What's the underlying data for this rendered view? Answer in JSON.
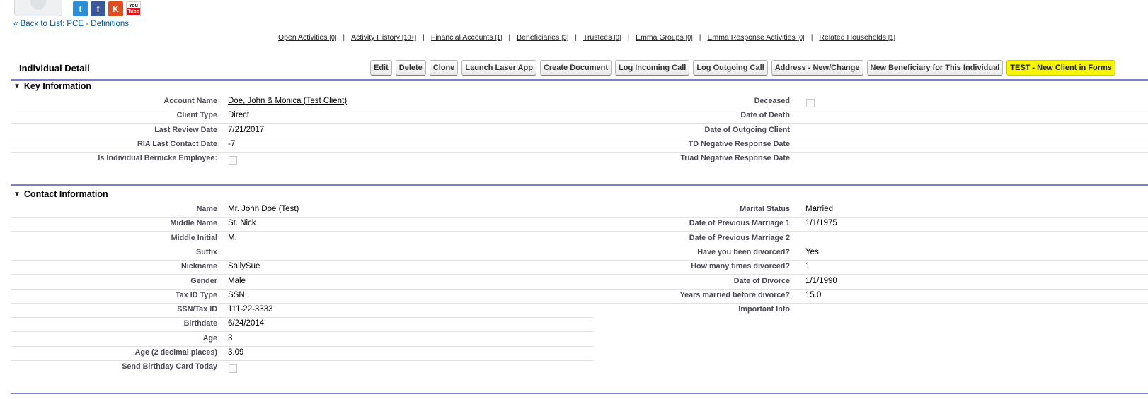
{
  "social": {
    "twitter": "t",
    "facebook": "f",
    "klout": "K",
    "youtube_top": "You",
    "youtube_bottom": "Tube"
  },
  "back_link": "« Back to List: PCE - Definitions",
  "related_lists": [
    {
      "label": "Open Activities",
      "count": "[0]"
    },
    {
      "label": "Activity History",
      "count": "[10+]"
    },
    {
      "label": "Financial Accounts",
      "count": "[1]"
    },
    {
      "label": "Beneficiaries",
      "count": "[3]"
    },
    {
      "label": "Trustees",
      "count": "[0]"
    },
    {
      "label": "Emma Groups",
      "count": "[0]"
    },
    {
      "label": "Emma Response Activities",
      "count": "[0]"
    },
    {
      "label": "Related Households",
      "count": "[1]"
    }
  ],
  "related_separator": "|",
  "detail": {
    "title": "Individual Detail",
    "buttons": [
      "Edit",
      "Delete",
      "Clone",
      "Launch Laser App",
      "Create Document",
      "Log Incoming Call",
      "Log Outgoing Call",
      "Address - New/Change",
      "New Beneficiary for This Individual",
      "TEST - New Client in Forms"
    ],
    "highlight_color": "#f6f600"
  },
  "key_info": {
    "title": "Key Information",
    "left": [
      {
        "label": "Account Name",
        "value": "Doe, John & Monica (Test Client)",
        "link": true
      },
      {
        "label": "Client Type",
        "value": "Direct"
      },
      {
        "label": "Last Review Date",
        "value": "7/21/2017"
      },
      {
        "label": "RIA Last Contact Date",
        "value": "-7"
      },
      {
        "label": "Is Individual Bernicke Employee:",
        "value": "",
        "checkbox": true
      }
    ],
    "right": [
      {
        "label": "Deceased",
        "value": "",
        "checkbox": true
      },
      {
        "label": "Date of Death",
        "value": ""
      },
      {
        "label": "Date of Outgoing Client",
        "value": ""
      },
      {
        "label": "TD Negative Response Date",
        "value": ""
      },
      {
        "label": "Triad Negative Response Date",
        "value": ""
      }
    ]
  },
  "contact_info": {
    "title": "Contact Information",
    "left": [
      {
        "label": "Name",
        "value": "Mr. John Doe (Test)"
      },
      {
        "label": "Middle Name",
        "value": "St. Nick"
      },
      {
        "label": "Middle Initial",
        "value": "M."
      },
      {
        "label": "Suffix",
        "value": ""
      },
      {
        "label": "Nickname",
        "value": "SallySue"
      },
      {
        "label": "Gender",
        "value": "Male"
      },
      {
        "label": "Tax ID Type",
        "value": "SSN"
      },
      {
        "label": "SSN/Tax ID",
        "value": "111-22-3333"
      },
      {
        "label": "Birthdate",
        "value": "6/24/2014"
      },
      {
        "label": "Age",
        "value": "3"
      },
      {
        "label": "Age (2 decimal places)",
        "value": "3.09"
      },
      {
        "label": "Send Birthday Card Today",
        "value": "",
        "checkbox": true
      }
    ],
    "right": [
      {
        "label": "Marital Status",
        "value": "Married"
      },
      {
        "label": "Date of Previous Marriage 1",
        "value": "1/1/1975"
      },
      {
        "label": "Date of Previous Marriage 2",
        "value": ""
      },
      {
        "label": "Have you been divorced?",
        "value": "Yes"
      },
      {
        "label": "How many times divorced?",
        "value": "1"
      },
      {
        "label": "Date of Divorce",
        "value": "1/1/1990"
      },
      {
        "label": "Years married before divorce?",
        "value": "15.0"
      },
      {
        "label": "Important Info",
        "value": ""
      }
    ]
  }
}
